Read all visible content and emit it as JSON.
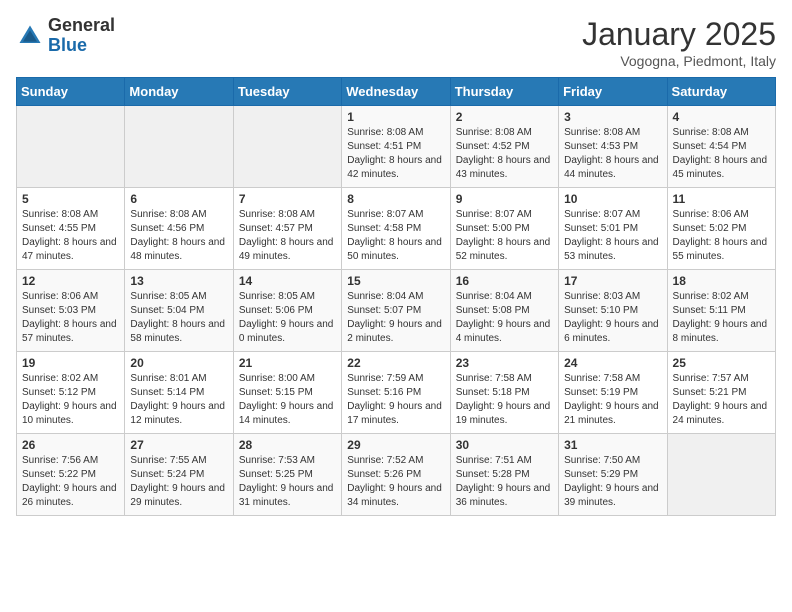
{
  "header": {
    "logo_general": "General",
    "logo_blue": "Blue",
    "month_title": "January 2025",
    "location": "Vogogna, Piedmont, Italy"
  },
  "days_of_week": [
    "Sunday",
    "Monday",
    "Tuesday",
    "Wednesday",
    "Thursday",
    "Friday",
    "Saturday"
  ],
  "weeks": [
    [
      {
        "day": "",
        "info": ""
      },
      {
        "day": "",
        "info": ""
      },
      {
        "day": "",
        "info": ""
      },
      {
        "day": "1",
        "info": "Sunrise: 8:08 AM\nSunset: 4:51 PM\nDaylight: 8 hours and 42 minutes."
      },
      {
        "day": "2",
        "info": "Sunrise: 8:08 AM\nSunset: 4:52 PM\nDaylight: 8 hours and 43 minutes."
      },
      {
        "day": "3",
        "info": "Sunrise: 8:08 AM\nSunset: 4:53 PM\nDaylight: 8 hours and 44 minutes."
      },
      {
        "day": "4",
        "info": "Sunrise: 8:08 AM\nSunset: 4:54 PM\nDaylight: 8 hours and 45 minutes."
      }
    ],
    [
      {
        "day": "5",
        "info": "Sunrise: 8:08 AM\nSunset: 4:55 PM\nDaylight: 8 hours and 47 minutes."
      },
      {
        "day": "6",
        "info": "Sunrise: 8:08 AM\nSunset: 4:56 PM\nDaylight: 8 hours and 48 minutes."
      },
      {
        "day": "7",
        "info": "Sunrise: 8:08 AM\nSunset: 4:57 PM\nDaylight: 8 hours and 49 minutes."
      },
      {
        "day": "8",
        "info": "Sunrise: 8:07 AM\nSunset: 4:58 PM\nDaylight: 8 hours and 50 minutes."
      },
      {
        "day": "9",
        "info": "Sunrise: 8:07 AM\nSunset: 5:00 PM\nDaylight: 8 hours and 52 minutes."
      },
      {
        "day": "10",
        "info": "Sunrise: 8:07 AM\nSunset: 5:01 PM\nDaylight: 8 hours and 53 minutes."
      },
      {
        "day": "11",
        "info": "Sunrise: 8:06 AM\nSunset: 5:02 PM\nDaylight: 8 hours and 55 minutes."
      }
    ],
    [
      {
        "day": "12",
        "info": "Sunrise: 8:06 AM\nSunset: 5:03 PM\nDaylight: 8 hours and 57 minutes."
      },
      {
        "day": "13",
        "info": "Sunrise: 8:05 AM\nSunset: 5:04 PM\nDaylight: 8 hours and 58 minutes."
      },
      {
        "day": "14",
        "info": "Sunrise: 8:05 AM\nSunset: 5:06 PM\nDaylight: 9 hours and 0 minutes."
      },
      {
        "day": "15",
        "info": "Sunrise: 8:04 AM\nSunset: 5:07 PM\nDaylight: 9 hours and 2 minutes."
      },
      {
        "day": "16",
        "info": "Sunrise: 8:04 AM\nSunset: 5:08 PM\nDaylight: 9 hours and 4 minutes."
      },
      {
        "day": "17",
        "info": "Sunrise: 8:03 AM\nSunset: 5:10 PM\nDaylight: 9 hours and 6 minutes."
      },
      {
        "day": "18",
        "info": "Sunrise: 8:02 AM\nSunset: 5:11 PM\nDaylight: 9 hours and 8 minutes."
      }
    ],
    [
      {
        "day": "19",
        "info": "Sunrise: 8:02 AM\nSunset: 5:12 PM\nDaylight: 9 hours and 10 minutes."
      },
      {
        "day": "20",
        "info": "Sunrise: 8:01 AM\nSunset: 5:14 PM\nDaylight: 9 hours and 12 minutes."
      },
      {
        "day": "21",
        "info": "Sunrise: 8:00 AM\nSunset: 5:15 PM\nDaylight: 9 hours and 14 minutes."
      },
      {
        "day": "22",
        "info": "Sunrise: 7:59 AM\nSunset: 5:16 PM\nDaylight: 9 hours and 17 minutes."
      },
      {
        "day": "23",
        "info": "Sunrise: 7:58 AM\nSunset: 5:18 PM\nDaylight: 9 hours and 19 minutes."
      },
      {
        "day": "24",
        "info": "Sunrise: 7:58 AM\nSunset: 5:19 PM\nDaylight: 9 hours and 21 minutes."
      },
      {
        "day": "25",
        "info": "Sunrise: 7:57 AM\nSunset: 5:21 PM\nDaylight: 9 hours and 24 minutes."
      }
    ],
    [
      {
        "day": "26",
        "info": "Sunrise: 7:56 AM\nSunset: 5:22 PM\nDaylight: 9 hours and 26 minutes."
      },
      {
        "day": "27",
        "info": "Sunrise: 7:55 AM\nSunset: 5:24 PM\nDaylight: 9 hours and 29 minutes."
      },
      {
        "day": "28",
        "info": "Sunrise: 7:53 AM\nSunset: 5:25 PM\nDaylight: 9 hours and 31 minutes."
      },
      {
        "day": "29",
        "info": "Sunrise: 7:52 AM\nSunset: 5:26 PM\nDaylight: 9 hours and 34 minutes."
      },
      {
        "day": "30",
        "info": "Sunrise: 7:51 AM\nSunset: 5:28 PM\nDaylight: 9 hours and 36 minutes."
      },
      {
        "day": "31",
        "info": "Sunrise: 7:50 AM\nSunset: 5:29 PM\nDaylight: 9 hours and 39 minutes."
      },
      {
        "day": "",
        "info": ""
      }
    ]
  ]
}
